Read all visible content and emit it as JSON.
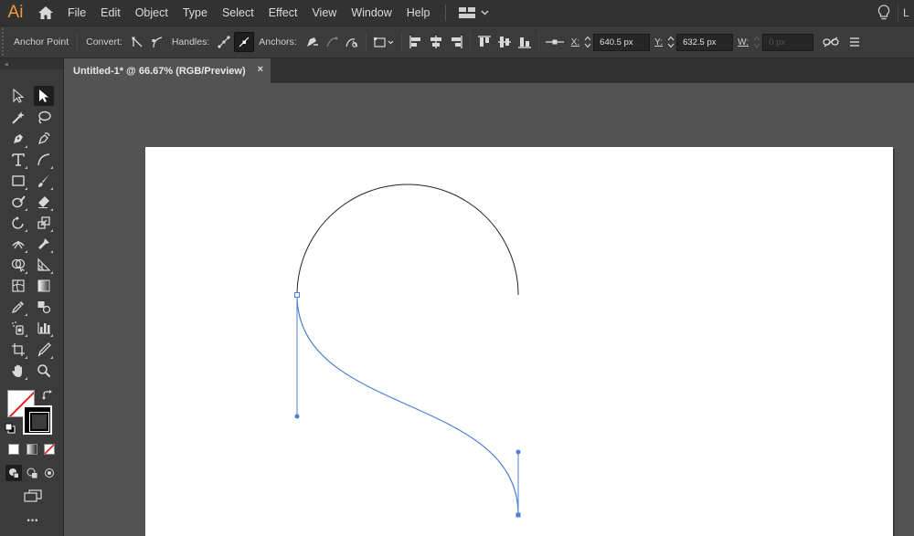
{
  "app": {
    "logo": "Ai",
    "user_initial": "L"
  },
  "menu": {
    "items": [
      "File",
      "Edit",
      "Object",
      "Type",
      "Select",
      "Effect",
      "View",
      "Window",
      "Help"
    ]
  },
  "controlbar": {
    "tool_name": "Anchor Point",
    "convert_label": "Convert:",
    "handles_label": "Handles:",
    "anchors_label": "Anchors:",
    "x_label": "X:",
    "x_value": "640.5 px",
    "y_label": "Y:",
    "y_value": "632.5 px",
    "w_label": "W:",
    "w_value": "0 px"
  },
  "document": {
    "tab_title": "Untitled-1* @ 66.67% (RGB/Preview)",
    "close_glyph": "×"
  },
  "toolpanel": {
    "collapse_glyph": "«",
    "more_glyph": "•••"
  },
  "colors": {
    "accent_logo": "#ee9a44",
    "selection_blue": "#4a7fd4",
    "chrome_dark": "#323232",
    "panel": "#3b3b3b",
    "workspace": "#535353",
    "artboard": "#ffffff"
  }
}
